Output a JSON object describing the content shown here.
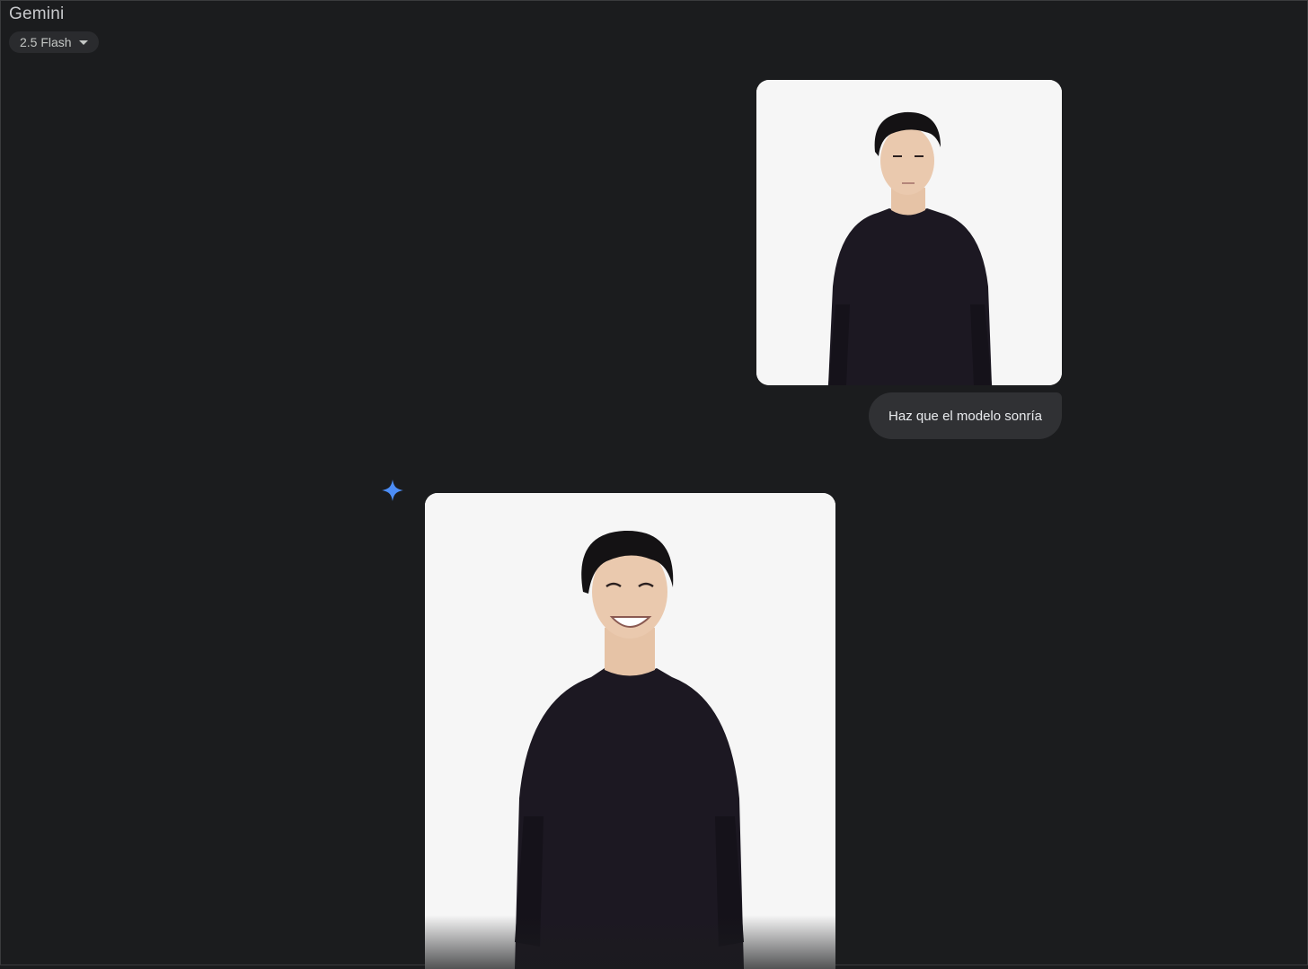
{
  "app": {
    "title": "Gemini"
  },
  "model_selector": {
    "label": "2.5 Flash",
    "icon": "dropdown-caret-icon"
  },
  "conversation": {
    "user_message": {
      "text": "Haz que el modelo sonría"
    },
    "response_icon": "gemini-sparkle-icon"
  },
  "colors": {
    "background": "#1b1c1e",
    "bubble": "#303134",
    "chip": "#2a2b2e",
    "sparkle": "#4c8df6",
    "photo_background": "#f6f6f6",
    "sweater": "#1c1822"
  }
}
